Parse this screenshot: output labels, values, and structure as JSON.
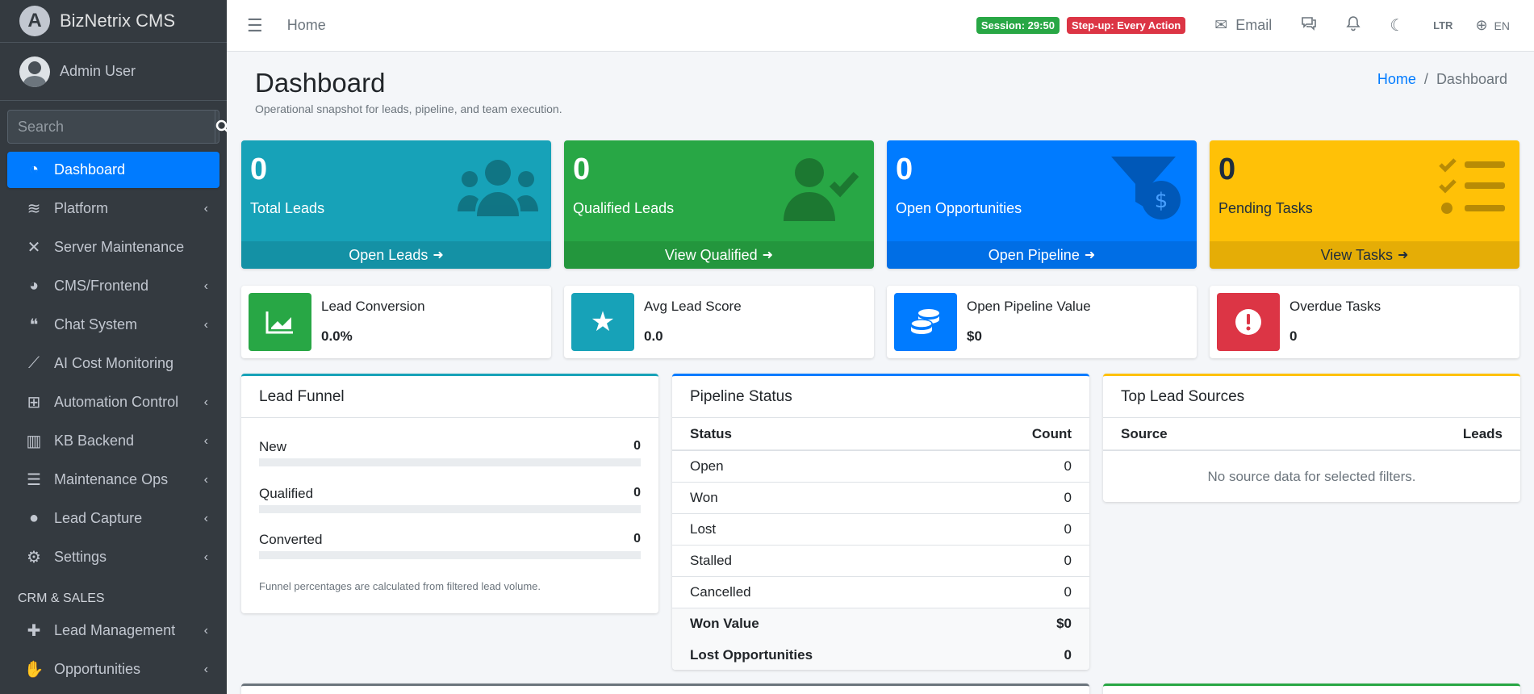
{
  "brand": {
    "logo_letter": "A",
    "name": "BizNetrix CMS"
  },
  "user": {
    "name": "Admin User"
  },
  "search": {
    "placeholder": "Search"
  },
  "sidebar": {
    "items": [
      {
        "label": "Dashboard",
        "icon": "tachometer-icon"
      },
      {
        "label": "Platform",
        "icon": "layers-icon"
      },
      {
        "label": "Server Maintenance",
        "icon": "tools-icon"
      },
      {
        "label": "CMS/Frontend",
        "icon": "palette-icon"
      },
      {
        "label": "Chat System",
        "icon": "comments-icon"
      },
      {
        "label": "AI Cost Monitoring",
        "icon": "chart-line-icon"
      },
      {
        "label": "Automation Control",
        "icon": "sitemap-icon"
      },
      {
        "label": "KB Backend",
        "icon": "book-icon"
      },
      {
        "label": "Maintenance Ops",
        "icon": "server-icon"
      },
      {
        "label": "Lead Capture",
        "icon": "users-icon"
      },
      {
        "label": "Settings",
        "icon": "gear-icon"
      }
    ],
    "section_header": "CRM & SALES",
    "crm_items": [
      {
        "label": "Lead Management",
        "icon": "user-plus-icon"
      },
      {
        "label": "Opportunities",
        "icon": "handshake-icon"
      }
    ]
  },
  "topbar": {
    "home_link": "Home",
    "session_badge": "Session: 29:50",
    "stepup_badge": "Step-up: Every Action",
    "email_label": "Email",
    "direction_label": "LTR",
    "language_label": "EN"
  },
  "page": {
    "title": "Dashboard",
    "subtitle": "Operational snapshot for leads, pipeline, and team execution.",
    "breadcrumb_home": "Home",
    "breadcrumb_current": "Dashboard"
  },
  "small_boxes": [
    {
      "value": "0",
      "label": "Total Leads",
      "link": "Open Leads",
      "icon": "users-icon"
    },
    {
      "value": "0",
      "label": "Qualified Leads",
      "link": "View Qualified",
      "icon": "user-check-icon"
    },
    {
      "value": "0",
      "label": "Open Opportunities",
      "link": "Open Pipeline",
      "icon": "funnel-dollar-icon"
    },
    {
      "value": "0",
      "label": "Pending Tasks",
      "link": "View Tasks",
      "icon": "tasks-icon"
    }
  ],
  "info_boxes": [
    {
      "label": "Lead Conversion",
      "value": "0.0%",
      "icon": "chart-area-icon"
    },
    {
      "label": "Avg Lead Score",
      "value": "0.0",
      "icon": "star-icon"
    },
    {
      "label": "Open Pipeline Value",
      "value": "$0",
      "icon": "coins-icon"
    },
    {
      "label": "Overdue Tasks",
      "value": "0",
      "icon": "exclamation-circle-icon"
    }
  ],
  "lead_funnel": {
    "title": "Lead Funnel",
    "rows": [
      {
        "label": "New",
        "value": "0"
      },
      {
        "label": "Qualified",
        "value": "0"
      },
      {
        "label": "Converted",
        "value": "0"
      }
    ],
    "note": "Funnel percentages are calculated from filtered lead volume."
  },
  "pipeline_status": {
    "title": "Pipeline Status",
    "col_status": "Status",
    "col_count": "Count",
    "rows": [
      {
        "status": "Open",
        "count": "0"
      },
      {
        "status": "Won",
        "count": "0"
      },
      {
        "status": "Lost",
        "count": "0"
      },
      {
        "status": "Stalled",
        "count": "0"
      },
      {
        "status": "Cancelled",
        "count": "0"
      }
    ],
    "won_value_label": "Won Value",
    "won_value": "$0",
    "lost_opps_label": "Lost Opportunities",
    "lost_opps": "0"
  },
  "lead_sources": {
    "title": "Top Lead Sources",
    "col_source": "Source",
    "col_leads": "Leads",
    "empty": "No source data for selected filters."
  },
  "colors": {
    "sidebar_bg": "#343a40",
    "primary": "#007bff",
    "info": "#17a2b8",
    "success": "#28a745",
    "warning": "#ffc107",
    "danger": "#dc3545"
  }
}
